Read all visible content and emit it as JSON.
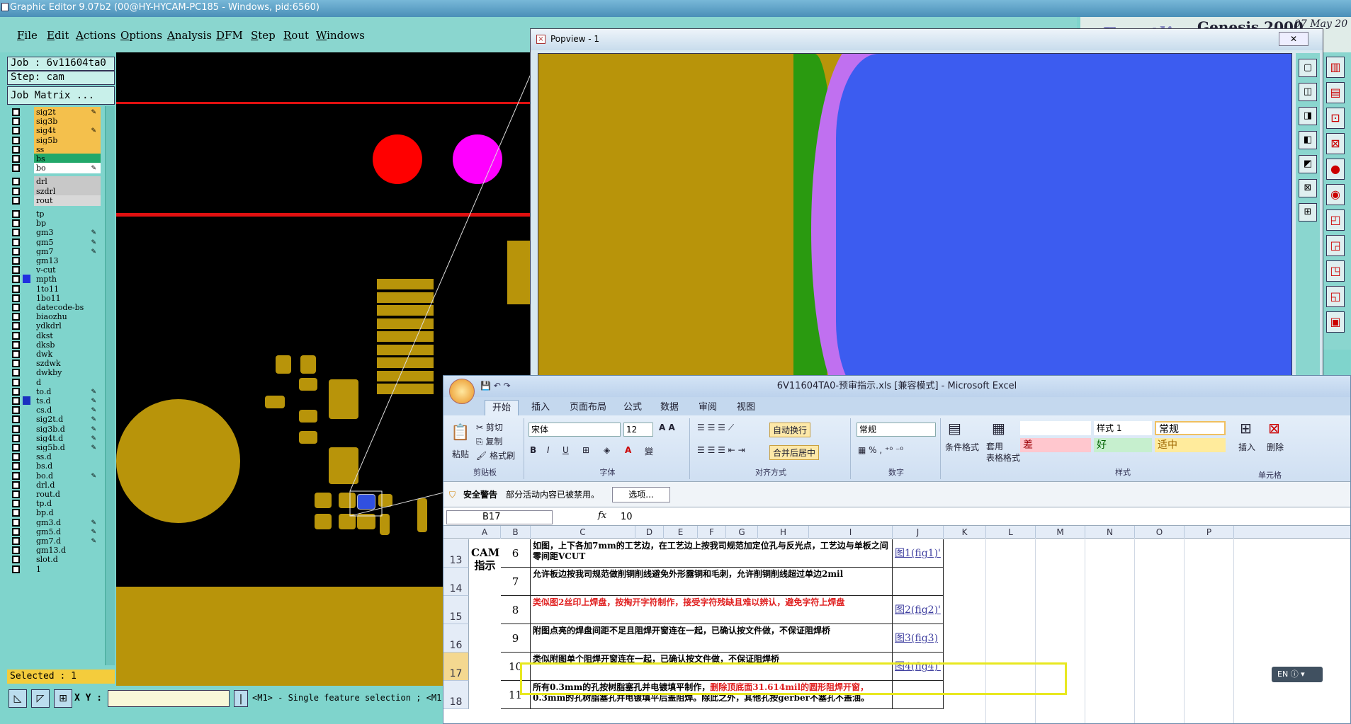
{
  "genesis": {
    "title": "Graphic Editor 9.07b2 (00@HY-HYCAM-PC185 - Windows, pid:6560)",
    "menu": [
      "File",
      "Edit",
      "Actions",
      "Options",
      "Analysis",
      "DFM",
      "Step",
      "Rout",
      "Windows"
    ],
    "job": "Job : 6v11604ta0",
    "step": "Step: cam",
    "job_matrix": "Job Matrix ...",
    "selected": "Selected : 1",
    "xy_label": "X Y :",
    "status": "<M1> - Single feature selection ; <M1",
    "layers": [
      {
        "name": "sig2t",
        "color": "#f4c04c",
        "pen": true
      },
      {
        "name": "sig3b",
        "color": "#f4c04c",
        "pen": false
      },
      {
        "name": "sig4t",
        "color": "#f4c04c",
        "pen": true
      },
      {
        "name": "sig5b",
        "color": "#f4c04c",
        "pen": false
      },
      {
        "name": "ss",
        "color": "#f4c04c",
        "pen": false
      },
      {
        "name": "bs",
        "color": "#22a86a",
        "pen": false
      },
      {
        "name": "bo",
        "color": "#ffffff",
        "pen": true
      },
      {
        "name": "drl",
        "color": "#c8c8c8",
        "pen": false
      },
      {
        "name": "szdrl",
        "color": "#c8c8c8",
        "pen": false
      },
      {
        "name": "rout",
        "color": "#d8d8d8",
        "pen": false
      },
      {
        "name": "tp",
        "color": "#7fd4cc",
        "pen": false
      },
      {
        "name": "bp",
        "color": "#7fd4cc",
        "pen": false
      },
      {
        "name": "gm3",
        "color": "#7fd4cc",
        "pen": true
      },
      {
        "name": "gm5",
        "color": "#7fd4cc",
        "pen": true
      },
      {
        "name": "gm7",
        "color": "#7fd4cc",
        "pen": true
      },
      {
        "name": "gm13",
        "color": "#7fd4cc",
        "pen": false
      },
      {
        "name": "v-cut",
        "color": "#7fd4cc",
        "pen": false
      },
      {
        "name": "mpth",
        "color": "#7fd4cc",
        "pen": false,
        "active": "#2030e0"
      },
      {
        "name": "1to11",
        "color": "#7fd4cc",
        "pen": false
      },
      {
        "name": "1bo11",
        "color": "#7fd4cc",
        "pen": false
      },
      {
        "name": "datecode-bs",
        "color": "#7fd4cc",
        "pen": false
      },
      {
        "name": "biaozhu",
        "color": "#7fd4cc",
        "pen": false
      },
      {
        "name": "ydkdrl",
        "color": "#7fd4cc",
        "pen": false
      },
      {
        "name": "dkst",
        "color": "#7fd4cc",
        "pen": false
      },
      {
        "name": "dksb",
        "color": "#7fd4cc",
        "pen": false
      },
      {
        "name": "dwk",
        "color": "#7fd4cc",
        "pen": false
      },
      {
        "name": "szdwk",
        "color": "#7fd4cc",
        "pen": false
      },
      {
        "name": "dwkby",
        "color": "#7fd4cc",
        "pen": false
      },
      {
        "name": "d",
        "color": "#7fd4cc",
        "pen": false
      },
      {
        "name": "to.d",
        "color": "#7fd4cc",
        "pen": true
      },
      {
        "name": "ts.d",
        "color": "#7fd4cc",
        "pen": true,
        "active": "#1a30c0"
      },
      {
        "name": "cs.d",
        "color": "#7fd4cc",
        "pen": true
      },
      {
        "name": "sig2t.d",
        "color": "#7fd4cc",
        "pen": true
      },
      {
        "name": "sig3b.d",
        "color": "#7fd4cc",
        "pen": true
      },
      {
        "name": "sig4t.d",
        "color": "#7fd4cc",
        "pen": true
      },
      {
        "name": "sig5b.d",
        "color": "#7fd4cc",
        "pen": true
      },
      {
        "name": "ss.d",
        "color": "#7fd4cc",
        "pen": false
      },
      {
        "name": "bs.d",
        "color": "#7fd4cc",
        "pen": false
      },
      {
        "name": "bo.d",
        "color": "#7fd4cc",
        "pen": true
      },
      {
        "name": "drl.d",
        "color": "#7fd4cc",
        "pen": false
      },
      {
        "name": "rout.d",
        "color": "#7fd4cc",
        "pen": false
      },
      {
        "name": "tp.d",
        "color": "#7fd4cc",
        "pen": false
      },
      {
        "name": "bp.d",
        "color": "#7fd4cc",
        "pen": false
      },
      {
        "name": "gm3.d",
        "color": "#7fd4cc",
        "pen": true
      },
      {
        "name": "gm5.d",
        "color": "#7fd4cc",
        "pen": true
      },
      {
        "name": "gm7.d",
        "color": "#7fd4cc",
        "pen": true
      },
      {
        "name": "gm13.d",
        "color": "#7fd4cc",
        "pen": false
      },
      {
        "name": "slot.d",
        "color": "#7fd4cc",
        "pen": false
      },
      {
        "name": "1",
        "color": "#7fd4cc",
        "pen": false
      }
    ],
    "logo": {
      "brand": "Frontline",
      "product": "Genesis 2000",
      "date": "07 May 20"
    }
  },
  "popview": {
    "title": "Popview - 1",
    "close_label": "✕"
  },
  "excel": {
    "title": "6V11604TA0-预审指示.xls [兼容模式] - Microsoft Excel",
    "tabs": [
      "开始",
      "插入",
      "页面布局",
      "公式",
      "数据",
      "审阅",
      "视图"
    ],
    "ribbon": {
      "paste": "粘贴",
      "cut": "剪切",
      "copy": "复制",
      "format_painter": "格式刷",
      "clipboard": "剪贴板",
      "font_name": "宋体",
      "font_size": "12",
      "font_group": "字体",
      "wrap_text": "自动换行",
      "merge_center": "合并后居中",
      "alignment": "对齐方式",
      "number_format": "常规",
      "number_group": "数字",
      "conditional": "条件格式",
      "table_format": "套用\n表格格式",
      "style1": "样式 1",
      "normal": "常规",
      "bad": "差",
      "good": "好",
      "neutral": "适中",
      "styles": "样式",
      "insert": "插入",
      "delete": "删除",
      "cells": "单元格"
    },
    "security": {
      "title": "安全警告",
      "message": "部分活动内容已被禁用。",
      "options": "选项..."
    },
    "name_box": "B17",
    "formula_value": "10",
    "columns": [
      "A",
      "B",
      "C",
      "D",
      "E",
      "F",
      "G",
      "H",
      "I",
      "J",
      "K",
      "L",
      "M",
      "N",
      "O",
      "P"
    ],
    "cam_label": "CAM\n指示",
    "rows": [
      {
        "row": "13",
        "num": "6",
        "text": "如图，上下各加7mm的工艺边，在工艺边上按我司规范加定位孔与反光点，工艺边与单板之间零间距VCUT",
        "red": "",
        "link": "图1(fig1)'"
      },
      {
        "row": "14",
        "num": "7",
        "text": "允许板边按我司规范做削铜削线避免外形露铜和毛刺，允许削铜削线超过单边2mil",
        "red": "",
        "link": ""
      },
      {
        "row": "15",
        "num": "8",
        "text": "",
        "red": "类似图2丝印上焊盘，按掏开字符制作，接受字符残缺且难以辨认，避免字符上焊盘",
        "link": "图2(fig2)'"
      },
      {
        "row": "16",
        "num": "9",
        "text": "附图点亮的焊盘间距不足且阻焊开窗连在一起，已确认按文件做，不保证阻焊桥",
        "red": "",
        "link": "图3(fig3)"
      },
      {
        "row": "17",
        "num": "10",
        "text": "类似附图单个阻焊开窗连在一起，已确认按文件做，不保证阻焊桥",
        "red": "",
        "link": "图4(fig4)'"
      },
      {
        "row": "18",
        "num": "11",
        "text": "所有0.3mm的孔按树脂塞孔并电镀填平制作，",
        "red": "删除顶底面31.614mil的圆形阻焊开窗，",
        "text2": "0.3mm的孔树脂塞孔并电镀填平后盖阻焊。除此之外，其他孔按gerber不塞孔不盖油。",
        "link": ""
      }
    ],
    "en_widget": "EN"
  }
}
